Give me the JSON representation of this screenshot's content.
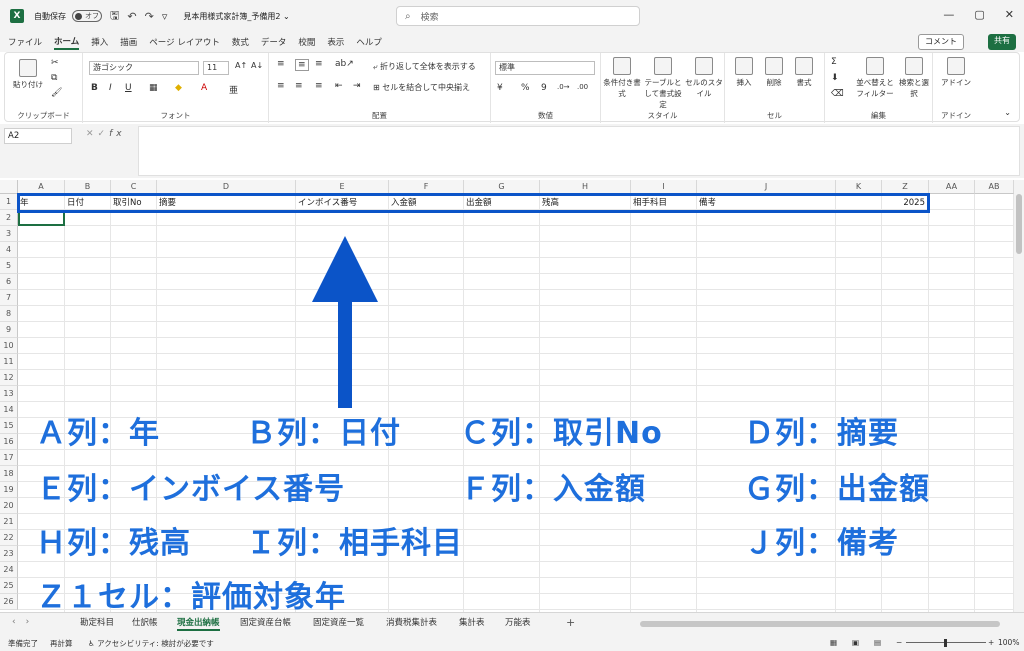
{
  "titlebar": {
    "app_icon": "X",
    "autosave_label": "自動保存",
    "toggle_label": "オフ",
    "title": "見本用様式家計簿_予備用2 ⌄",
    "search_placeholder": "検索",
    "window_controls": [
      "—",
      "▢",
      "✕"
    ]
  },
  "menu": {
    "items": [
      "ファイル",
      "ホーム",
      "挿入",
      "描画",
      "ページ レイアウト",
      "数式",
      "データ",
      "校閲",
      "表示",
      "ヘルプ"
    ],
    "active_index": 1,
    "comment_label": "コメント",
    "share_label": "共有"
  },
  "ribbon": {
    "clipboard": {
      "paste_label": "貼り付け",
      "group_label": "クリップボード"
    },
    "font": {
      "font_name": "游ゴシック",
      "font_size": "11",
      "group_label": "フォント"
    },
    "alignment": {
      "wrap_label": "折り返して全体を表示する",
      "merge_label": "セルを結合して中央揃え",
      "group_label": "配置"
    },
    "number": {
      "format": "標準",
      "group_label": "数値"
    },
    "styles": {
      "conditional_label": "条件付き書式",
      "table_label": "テーブルとして書式設定",
      "cell_style_label": "セルのスタイル",
      "group_label": "スタイル"
    },
    "cells": {
      "insert_label": "挿入",
      "delete_label": "削除",
      "format_label": "書式",
      "group_label": "セル"
    },
    "editing": {
      "sort_label": "並べ替えとフィルター",
      "find_label": "検索と選択",
      "group_label": "編集"
    },
    "addins": {
      "addin_label": "アドイン",
      "group_label": "アドイン"
    }
  },
  "formula": {
    "namebox": "A2",
    "fx": "fx"
  },
  "grid": {
    "columns": [
      "A",
      "B",
      "C",
      "D",
      "E",
      "F",
      "G",
      "H",
      "I",
      "J",
      "K",
      "Z",
      "AA",
      "AB"
    ],
    "rows": [
      "1",
      "2",
      "3",
      "4",
      "5",
      "6",
      "7",
      "8",
      "9",
      "10",
      "11",
      "12",
      "13",
      "14",
      "15",
      "16",
      "17",
      "18",
      "19",
      "20",
      "21",
      "22",
      "23",
      "24",
      "25",
      "26"
    ],
    "row1": {
      "A": "年",
      "B": "日付",
      "C": "取引No",
      "D": "摘要",
      "E": "インボイス番号",
      "F": "入金額",
      "G": "出金額",
      "H": "残高",
      "I": "相手科目",
      "J": "備考",
      "Z": "2025"
    }
  },
  "annotations": [
    "Ａ列：年",
    "Ｂ列：日付",
    "Ｃ列：取引No",
    "Ｄ列：摘要",
    "Ｅ列：インボイス番号",
    "Ｆ列：入金額",
    "Ｇ列：出金額",
    "Ｈ列：残高",
    "Ｉ列：相手科目",
    "Ｊ列：備考",
    "Ｚ１セル：評価対象年"
  ],
  "sheets": {
    "tabs": [
      "勘定科目",
      "仕訳帳",
      "現金出納帳",
      "固定資産台帳",
      "固定資産一覧",
      "消費税集計表",
      "集計表",
      "万能表"
    ],
    "active_index": 2,
    "add": "+"
  },
  "status": {
    "ready": "準備完了",
    "recalc": "再計算",
    "accessibility": "アクセシビリティ: 検討が必要です",
    "zoom": "100%"
  },
  "colors": {
    "excel_green": "#1d6f42",
    "annotation_blue": "#1e6fdc",
    "highlight_border": "#0b54c8"
  }
}
